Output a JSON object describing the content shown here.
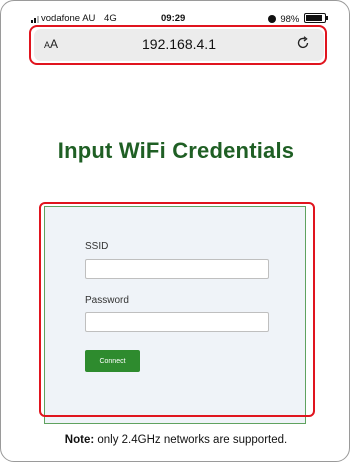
{
  "status_bar": {
    "carrier": "vodafone AU",
    "network": "4G",
    "time": "09:29",
    "battery": "98%",
    "battery_level": 0.98
  },
  "browser": {
    "text_size_label": "AA",
    "url": "192.168.4.1",
    "reload_icon": "reload-icon"
  },
  "page": {
    "heading": "Input WiFi Credentials",
    "form": {
      "ssid_label": "SSID",
      "ssid_value": "",
      "password_label": "Password",
      "password_value": "",
      "submit_label": "Connect"
    },
    "note": {
      "prefix": "Note:",
      "text": " only 2.4GHz networks are supported."
    }
  },
  "colors": {
    "heading": "#1f5f24",
    "button": "#2e8b2e",
    "highlight": "#e0141e",
    "form_border": "#5fa25f",
    "form_bg": "#eff3f8"
  }
}
